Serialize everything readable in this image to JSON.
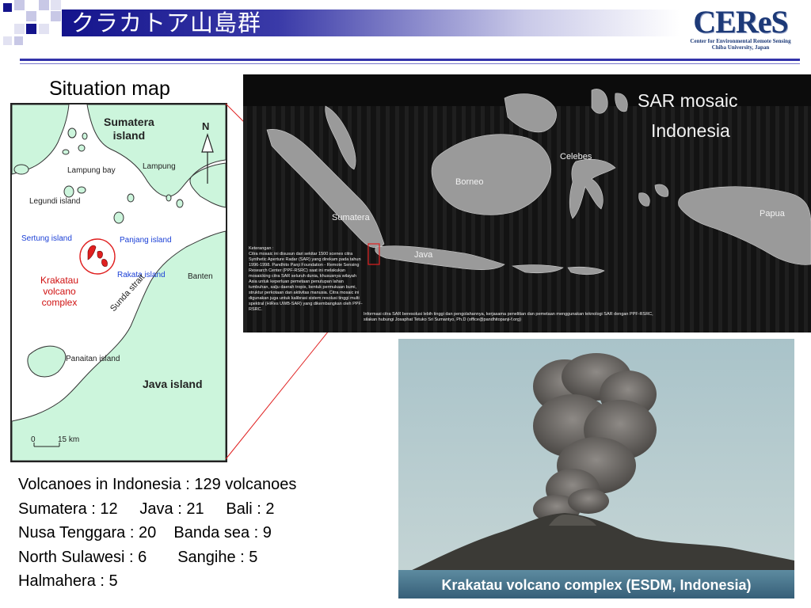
{
  "header": {
    "title": "クラカトア山島群",
    "logo": {
      "main": "CEReS",
      "line1": "Center for Environmental Remote Sensing",
      "line2": "Chiba University, Japan"
    }
  },
  "colors": {
    "title_bar": "#14148c",
    "rule": "#3333aa",
    "land": "#ccf5dc",
    "marker": "#e02020"
  },
  "map": {
    "title": "Situation map",
    "north": "N",
    "labels": {
      "sumatera": "Sumatera\nisland",
      "lampung": "Lampung",
      "lampung_bay": "Lampung bay",
      "legundi": "Legundi island",
      "sertung": "Sertung island",
      "panjang": "Panjang island",
      "rakata": "Rakata island",
      "banten": "Banten",
      "krakatau": "Krakatau\nvolcano\ncomplex",
      "sunda": "Sunda strait",
      "panaitan": "Panaitan island",
      "java": "Java island"
    },
    "scale": {
      "zero": "0",
      "max": "15 km"
    }
  },
  "sar": {
    "title_line1": "SAR mosaic",
    "title_line2": "Indonesia",
    "labels": {
      "borneo": "Borneo",
      "celebes": "Celebes",
      "sumatera": "Sumatera",
      "java": "Java",
      "papua": "Papua"
    },
    "notes_heading": "Keterangan :",
    "notes_left": "Citra mosaic ini disusun dari sekitar 1500 scenes citra Synthetic Aperture Radar (SAR) yang direkam pada tahun 1996-1998. Pandhito Panji Foundation - Remote Sensing Research Center (PPF-RSRC) saat ini melakukan mosaicking citra SAR seluruh dunia, khususnya wilayah Asia untuk keperluan pemetaan penutupan lahan tumbuhan, salju daerah tropis, bentuk permukaan bumi, struktur perkotaan dan aktivitas manusia. Citra mosaic ini digunakan juga untuk kalibrasi sistem resolusi tinggi multi spektral (HiRes UWB-SAR) yang dikembangkan oleh PPF-RSRC.",
    "notes_right": "Informasi citra SAR beresolusi lebih tinggi dan pengolahannya, kerjasama penelitian dan pemetaan menggunakan teknologi SAR dengan PPF-RSRC, silakan hubungi Josaphat Tetuko Sri Sumantyo, Ph.D (office@pandhitopanji-f.org)"
  },
  "photo": {
    "caption": "Krakatau volcano complex (ESDM, Indonesia)"
  },
  "stats": {
    "line1": "Volcanoes in Indonesia : 129 volcanoes",
    "line2": "Sumatera : 12     Java : 21     Bali : 2",
    "line3": "Nusa Tenggara : 20    Banda sea : 9",
    "line4": "North Sulawesi : 6       Sangihe : 5",
    "line5": "Halmahera : 5"
  }
}
